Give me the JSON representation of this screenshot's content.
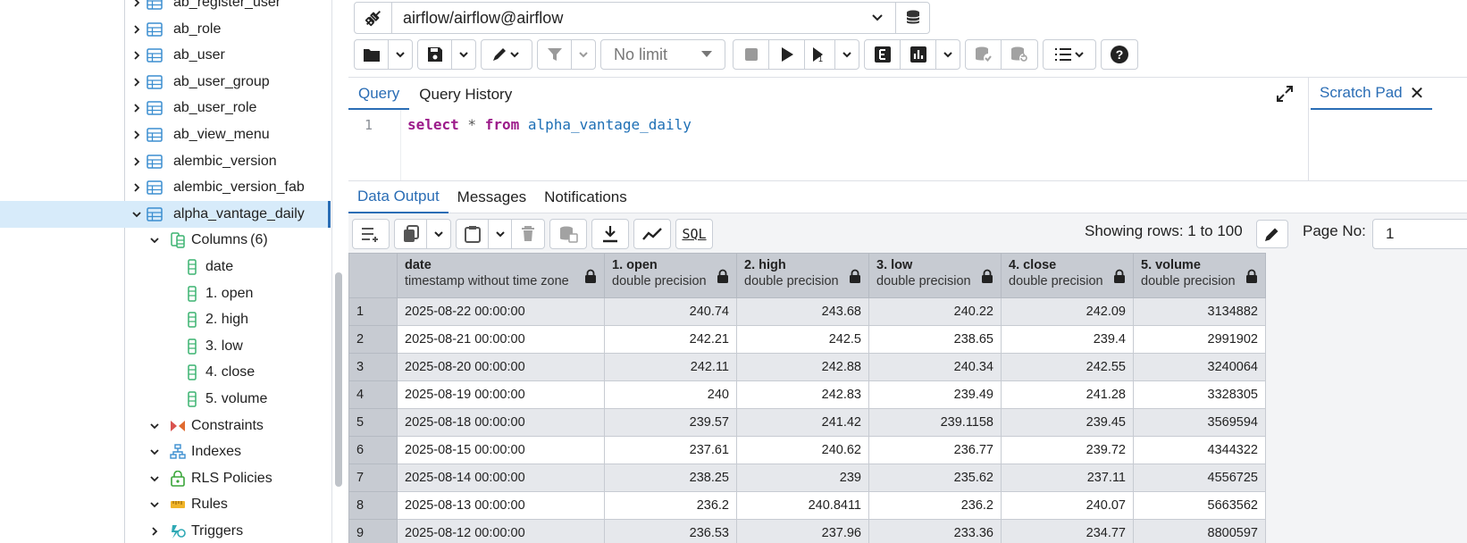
{
  "sidebar": {
    "tables": [
      {
        "label": "ab_register_user",
        "expanded": false
      },
      {
        "label": "ab_role",
        "expanded": false
      },
      {
        "label": "ab_user",
        "expanded": false
      },
      {
        "label": "ab_user_group",
        "expanded": false
      },
      {
        "label": "ab_user_role",
        "expanded": false
      },
      {
        "label": "ab_view_menu",
        "expanded": false
      },
      {
        "label": "alembic_version",
        "expanded": false
      },
      {
        "label": "alembic_version_fab",
        "expanded": false
      },
      {
        "label": "alpha_vantage_daily",
        "expanded": true
      }
    ],
    "columns_node": {
      "label": "Columns",
      "count": "(6)"
    },
    "columns": [
      "date",
      "1. open",
      "2. high",
      "3. low",
      "4. close",
      "5. volume"
    ],
    "subnodes": [
      "Constraints",
      "Indexes",
      "RLS Policies",
      "Rules",
      "Triggers"
    ]
  },
  "connection": {
    "label": "airflow/airflow@airflow"
  },
  "toolbar": {
    "limit_label": "No limit"
  },
  "query_tabs": [
    {
      "label": "Query",
      "active": true
    },
    {
      "label": "Query History",
      "active": false
    }
  ],
  "scratch_pad": {
    "label": "Scratch Pad",
    "close": "✕"
  },
  "editor": {
    "line_number": "1",
    "tokens": {
      "kw1": "select",
      "op": " * ",
      "kw2": "from",
      "table": " alpha_vantage_daily"
    }
  },
  "result_tabs": [
    {
      "label": "Data Output",
      "active": true
    },
    {
      "label": "Messages",
      "active": false
    },
    {
      "label": "Notifications",
      "active": false
    }
  ],
  "result_toolbar": {
    "rows_info": "Showing rows: 1 to 100",
    "page_label": "Page No:",
    "page_value": "1",
    "sql_label": "SQL"
  },
  "grid": {
    "columns": [
      {
        "name": "date",
        "type": "timestamp without time zone"
      },
      {
        "name": "1. open",
        "type": "double precision"
      },
      {
        "name": "2. high",
        "type": "double precision"
      },
      {
        "name": "3. low",
        "type": "double precision"
      },
      {
        "name": "4. close",
        "type": "double precision"
      },
      {
        "name": "5. volume",
        "type": "double precision"
      }
    ],
    "rows": [
      [
        "1",
        "2025-08-22 00:00:00",
        "240.74",
        "243.68",
        "240.22",
        "242.09",
        "3134882"
      ],
      [
        "2",
        "2025-08-21 00:00:00",
        "242.21",
        "242.5",
        "238.65",
        "239.4",
        "2991902"
      ],
      [
        "3",
        "2025-08-20 00:00:00",
        "242.11",
        "242.88",
        "240.34",
        "242.55",
        "3240064"
      ],
      [
        "4",
        "2025-08-19 00:00:00",
        "240",
        "242.83",
        "239.49",
        "241.28",
        "3328305"
      ],
      [
        "5",
        "2025-08-18 00:00:00",
        "239.57",
        "241.42",
        "239.1158",
        "239.45",
        "3569594"
      ],
      [
        "6",
        "2025-08-15 00:00:00",
        "237.61",
        "240.62",
        "236.77",
        "239.72",
        "4344322"
      ],
      [
        "7",
        "2025-08-14 00:00:00",
        "238.25",
        "239",
        "235.62",
        "237.11",
        "4556725"
      ],
      [
        "8",
        "2025-08-13 00:00:00",
        "236.2",
        "240.8411",
        "236.2",
        "240.07",
        "5663562"
      ],
      [
        "9",
        "2025-08-12 00:00:00",
        "236.53",
        "237.96",
        "233.36",
        "234.77",
        "8800597"
      ]
    ]
  },
  "colors": {
    "accent": "#2a6db5",
    "selected_row": "#d7ebfa",
    "header_bg": "#c7cbd2",
    "keyword": "#9c1b8a"
  }
}
